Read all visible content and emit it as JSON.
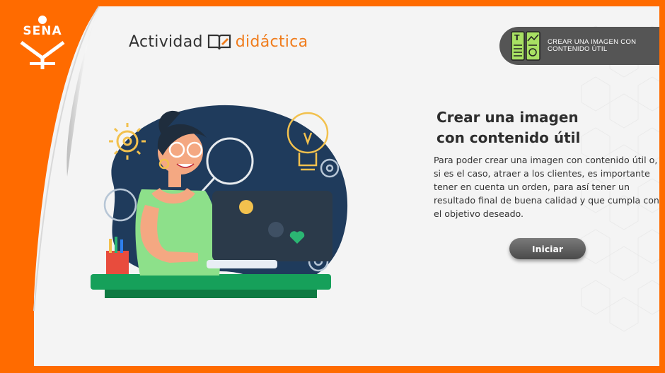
{
  "brand": {
    "logo_text": "SENA"
  },
  "header": {
    "word1": "Actividad",
    "word2": "didáctica"
  },
  "badge": {
    "label": "CREAR UNA IMAGEN CON CONTENIDO ÚTIL",
    "icon": "infographic-icon"
  },
  "main": {
    "title": "Crear una imagen\ncon contenido útil",
    "description": "Para poder crear una imagen con contenido útil o, si es el caso, atraer a los clientes, es importante tener en cuenta un orden, para así tener un resultado final de buena calidad y que cumpla con el objetivo deseado.",
    "start_button": "Iniciar"
  },
  "colors": {
    "accent": "#ff6b00",
    "dark": "#555555",
    "navy": "#1f3b5c",
    "green": "#2bb673"
  }
}
